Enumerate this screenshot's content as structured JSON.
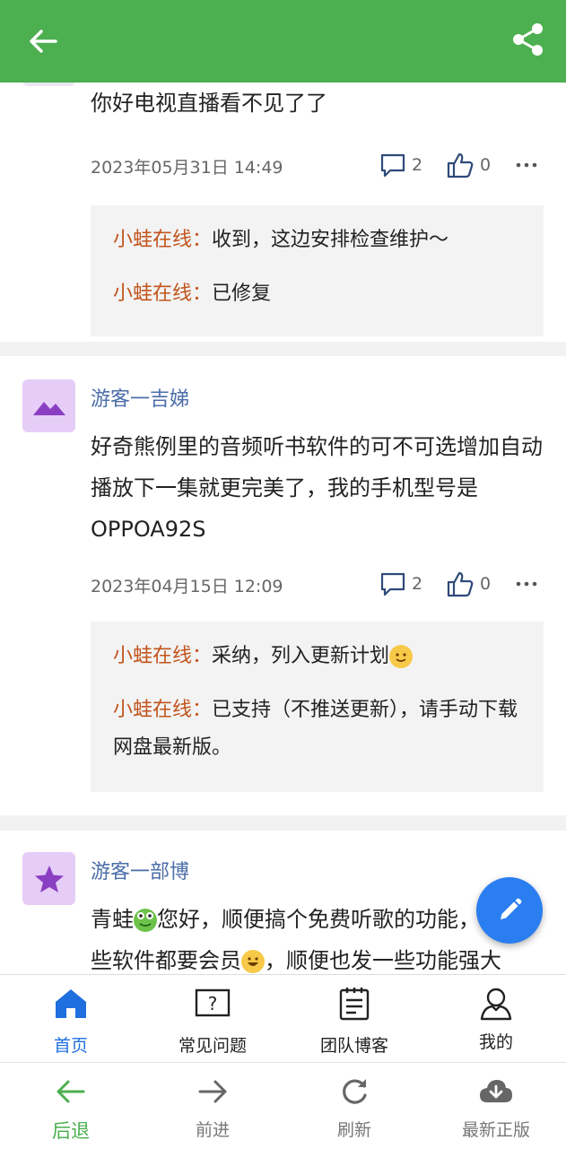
{
  "header": {
    "back_icon": "arrow-left-icon",
    "share_icon": "share-icon",
    "color": "#4caf50"
  },
  "posts": [
    {
      "content": "你好电视直播看不见了了",
      "date": "2023年05月31日 14:49",
      "comments": "2",
      "likes": "0",
      "replies": [
        {
          "author": "小蛙在线：",
          "text": "收到，这边安排检查维护～"
        },
        {
          "author": "小蛙在线：",
          "text": "已修复"
        }
      ]
    },
    {
      "username": "游客一吉娣",
      "avatar_icon": "mountain-icon",
      "content": "好奇熊例里的音频听书软件的可不可选增加自动播放下一集就更完美了，我的手机型号是OPPOA92S",
      "date": "2023年04月15日 12:09",
      "comments": "2",
      "likes": "0",
      "replies": [
        {
          "author": "小蛙在线：",
          "text": "采纳，列入更新计划"
        },
        {
          "author": "小蛙在线：",
          "text": "已支持（不推送更新），请手动下载网盘最新版。"
        }
      ]
    },
    {
      "username": "游客一部博",
      "avatar_icon": "star-icon",
      "content_parts": [
        "青蛙",
        "您好，顺便搞个免费听歌的功能，",
        "些软件都要会员",
        "，顺便也发一些功能强大"
      ]
    }
  ],
  "fab_icon": "pencil-icon",
  "tabs": [
    {
      "label": "首页",
      "icon": "home-icon",
      "active": true
    },
    {
      "label": "常见问题",
      "icon": "question-icon",
      "active": false
    },
    {
      "label": "团队博客",
      "icon": "notepad-icon",
      "active": false
    },
    {
      "label": "我的",
      "icon": "user-icon",
      "active": false
    }
  ],
  "nav": [
    {
      "label": "后退",
      "icon": "back-arrow-icon"
    },
    {
      "label": "前进",
      "icon": "forward-arrow-icon"
    },
    {
      "label": "刷新",
      "icon": "refresh-icon"
    },
    {
      "label": "最新正版",
      "icon": "cloud-download-icon"
    }
  ],
  "colors": {
    "accent": "#4caf50",
    "active_tab": "#1f6fe0",
    "author": "#c2541c",
    "username": "#4b6ea8"
  }
}
